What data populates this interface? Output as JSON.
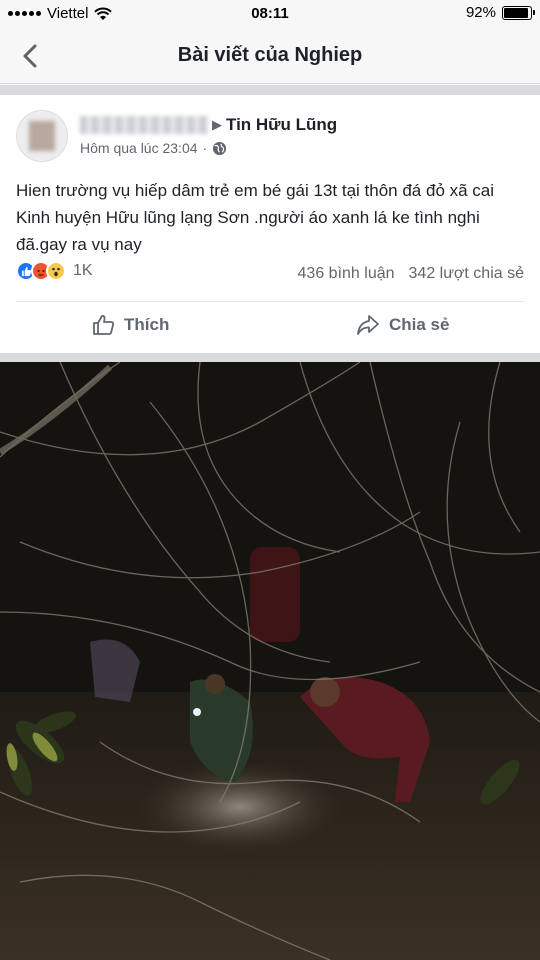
{
  "status_bar": {
    "carrier": "Viettel",
    "time": "08:11",
    "battery": "92%",
    "battery_level": 0.92
  },
  "nav": {
    "title": "Bài viết của Nghiep"
  },
  "post": {
    "page_name": "Tin Hữu Lũng",
    "timestamp": "Hôm qua lúc 23:04",
    "separator": "·",
    "text": "Hien trường vụ hiếp dâm trẻ em bé gái 13t  tại thôn đá đỏ xã cai Kinh huyện Hữu lũng lạng Sơn .người áo xanh  lá ke tình nghi đã.gay ra vụ nay",
    "reaction_count": "1K",
    "comments": "436 bình luận",
    "shares": "342 lượt chia sẻ",
    "like_label": "Thích",
    "share_label": "Chia sẻ"
  },
  "icons": {
    "back": "chevron-left-icon",
    "privacy": "globe-icon",
    "like": "thumbs-up-icon",
    "share": "share-arrow-icon",
    "wifi": "wifi-icon",
    "reactions": [
      "like-reaction-icon",
      "angry-reaction-icon",
      "wow-reaction-icon"
    ]
  },
  "colors": {
    "facebook_blue": "#1877f2",
    "text": "#1d2129",
    "secondary": "#606770",
    "background_band": "#d9dade"
  }
}
